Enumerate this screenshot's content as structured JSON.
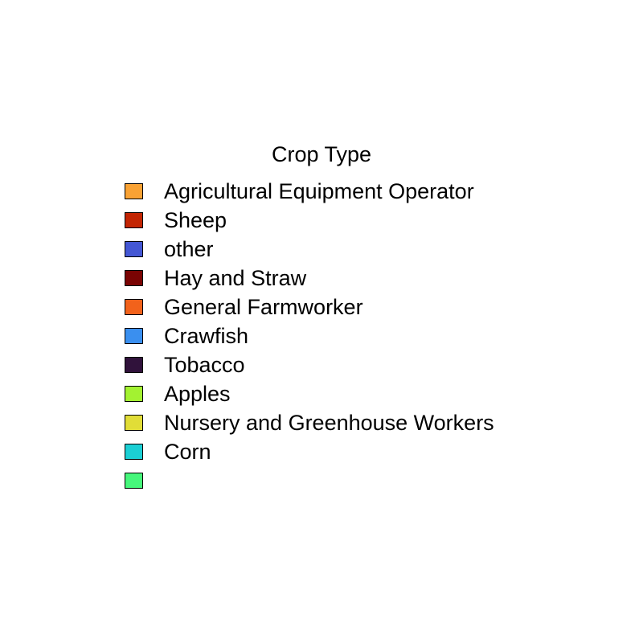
{
  "chart_data": {
    "type": "legend",
    "title": "Crop Type",
    "legend_placement": "center",
    "entries": [
      {
        "label": "Agricultural Equipment Operator",
        "color": "#F9A234"
      },
      {
        "label": "Sheep",
        "color": "#C32503"
      },
      {
        "label": "other",
        "color": "#4457D4"
      },
      {
        "label": "Hay and Straw",
        "color": "#7A0403"
      },
      {
        "label": "General Farmworker",
        "color": "#F2621B"
      },
      {
        "label": "Crawfish",
        "color": "#3A8FEF"
      },
      {
        "label": "Tobacco",
        "color": "#30123B"
      },
      {
        "label": "Apples",
        "color": "#A3F231"
      },
      {
        "label": "Nursery and Greenhouse Workers",
        "color": "#E1DD37"
      },
      {
        "label": "Corn",
        "color": "#1BCFD4"
      },
      {
        "label": "",
        "color": "#46F77B"
      }
    ]
  }
}
